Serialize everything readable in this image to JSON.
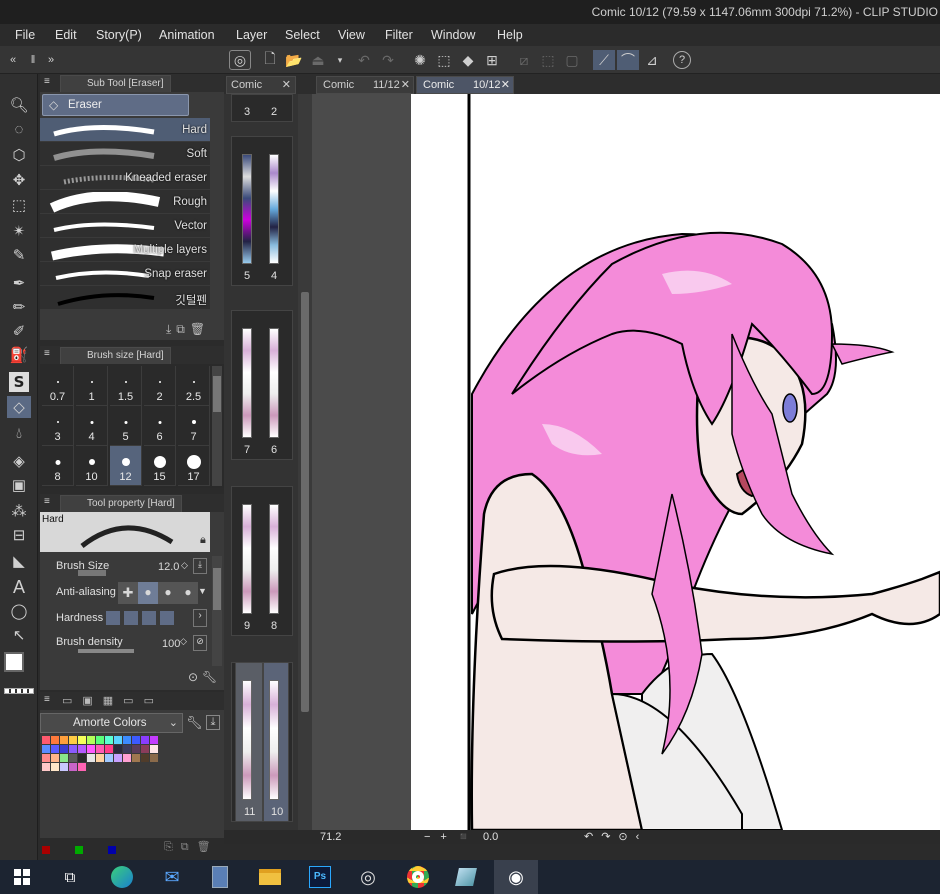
{
  "title": "Comic 10/12 (79.59 x 1147.06mm 300dpi 71.2%) - CLIP STUDIO",
  "menu": [
    "File",
    "Edit",
    "Story(P)",
    "Animation",
    "Layer",
    "Select",
    "View",
    "Filter",
    "Window",
    "Help"
  ],
  "subtool": {
    "header": "Sub Tool [Eraser]",
    "group": "Eraser",
    "items": [
      "Hard",
      "Soft",
      "Kneaded eraser",
      "Rough",
      "Vector",
      "Multiple layers",
      "Snap eraser",
      "깃털펜"
    ]
  },
  "brushsize": {
    "header": "Brush size [Hard]",
    "sizes": [
      "0.7",
      "1",
      "1.5",
      "2",
      "2.5",
      "3",
      "4",
      "5",
      "6",
      "7",
      "8",
      "10",
      "12",
      "15",
      "17"
    ],
    "selected": "12"
  },
  "toolprop": {
    "header": "Tool property [Hard]",
    "preview_label": "Hard",
    "brush_size_label": "Brush Size",
    "brush_size_value": "12.0",
    "antialias_label": "Anti-aliasing",
    "hardness_label": "Hardness",
    "density_label": "Brush density",
    "density_value": "100"
  },
  "colorset": {
    "name": "Amorte Colors",
    "colors": [
      "#ff5a6e",
      "#ff7a3c",
      "#ff9f3c",
      "#ffcc44",
      "#f6ff5a",
      "#b4ff5a",
      "#5aff7a",
      "#5affd2",
      "#5ad2ff",
      "#3c8cff",
      "#3c5aff",
      "#8a3cff",
      "#c43cff",
      "#5a8cff",
      "#5a5aff",
      "#3c3cd2",
      "#8a5aff",
      "#b45aff",
      "#ff5aff",
      "#ff5ab4",
      "#ff3c8a",
      "#2a2a3c",
      "#3c3c5a",
      "#5a3c5a",
      "#8a3c5a",
      "#ffe6e6",
      "#ff8a8a",
      "#ffb48a",
      "#8ae68a",
      "#5a5a5a",
      "#2a2a2a",
      "#e6e6e6",
      "#ffd2a0",
      "#a0c8ff",
      "#c8a0ff",
      "#ffa0d2",
      "#a07850",
      "#503c2a",
      "#8a6a4a",
      "#ffc8c8",
      "#ffe6c8",
      "#c8c8ff",
      "#c864c8",
      "#ff64b4"
    ],
    "footer_swatches": [
      "#aa0000",
      "#00aa00",
      "#0000aa"
    ]
  },
  "pages": {
    "rows": [
      [
        "3",
        "2"
      ],
      [
        "5",
        "4"
      ],
      [
        "7",
        "6"
      ],
      [
        "9",
        "8"
      ],
      [
        "11",
        "10"
      ]
    ]
  },
  "doctabs": [
    "Comic",
    "Comic",
    "11/12",
    "Comic",
    "10/12"
  ],
  "status": {
    "zoom": "71.2",
    "angle": "0.0"
  }
}
